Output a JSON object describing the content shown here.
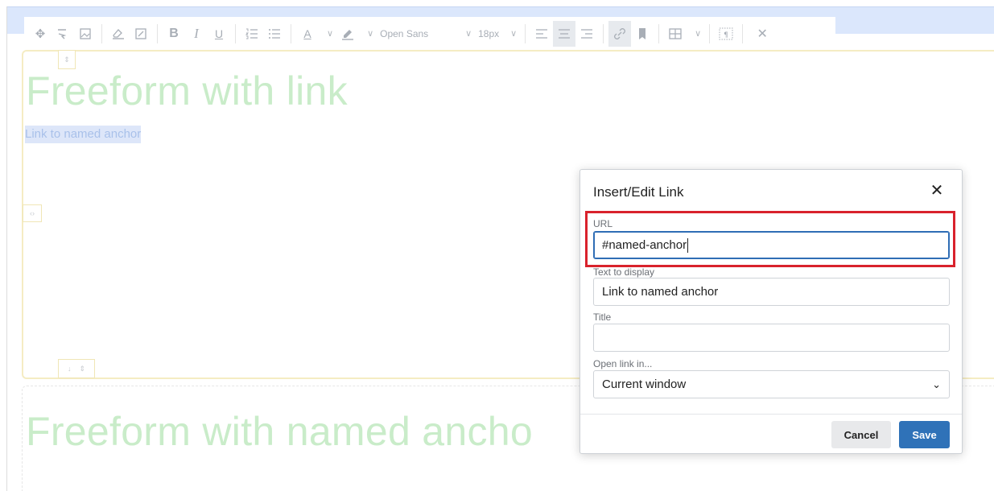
{
  "toolbar": {
    "font_family": "Open Sans",
    "font_size": "18px",
    "bold": "B",
    "italic": "I",
    "underline": "U",
    "text_color_glyph": "A"
  },
  "editor": {
    "heading1": "Freeform with link",
    "selected_link_text": "Link to named anchor",
    "heading2": "Freeform with named ancho"
  },
  "dialog": {
    "title": "Insert/Edit Link",
    "close": "✕",
    "url_label": "URL",
    "url_value": "#named-anchor",
    "text_label": "Text to display",
    "text_value": "Link to named anchor",
    "title_label": "Title",
    "title_value": "",
    "target_label": "Open link in...",
    "target_value": "Current window",
    "cancel_label": "Cancel",
    "save_label": "Save"
  },
  "colors": {
    "accent": "#2f72b8",
    "highlight": "#d9222c",
    "heading": "#c9ecc9"
  }
}
